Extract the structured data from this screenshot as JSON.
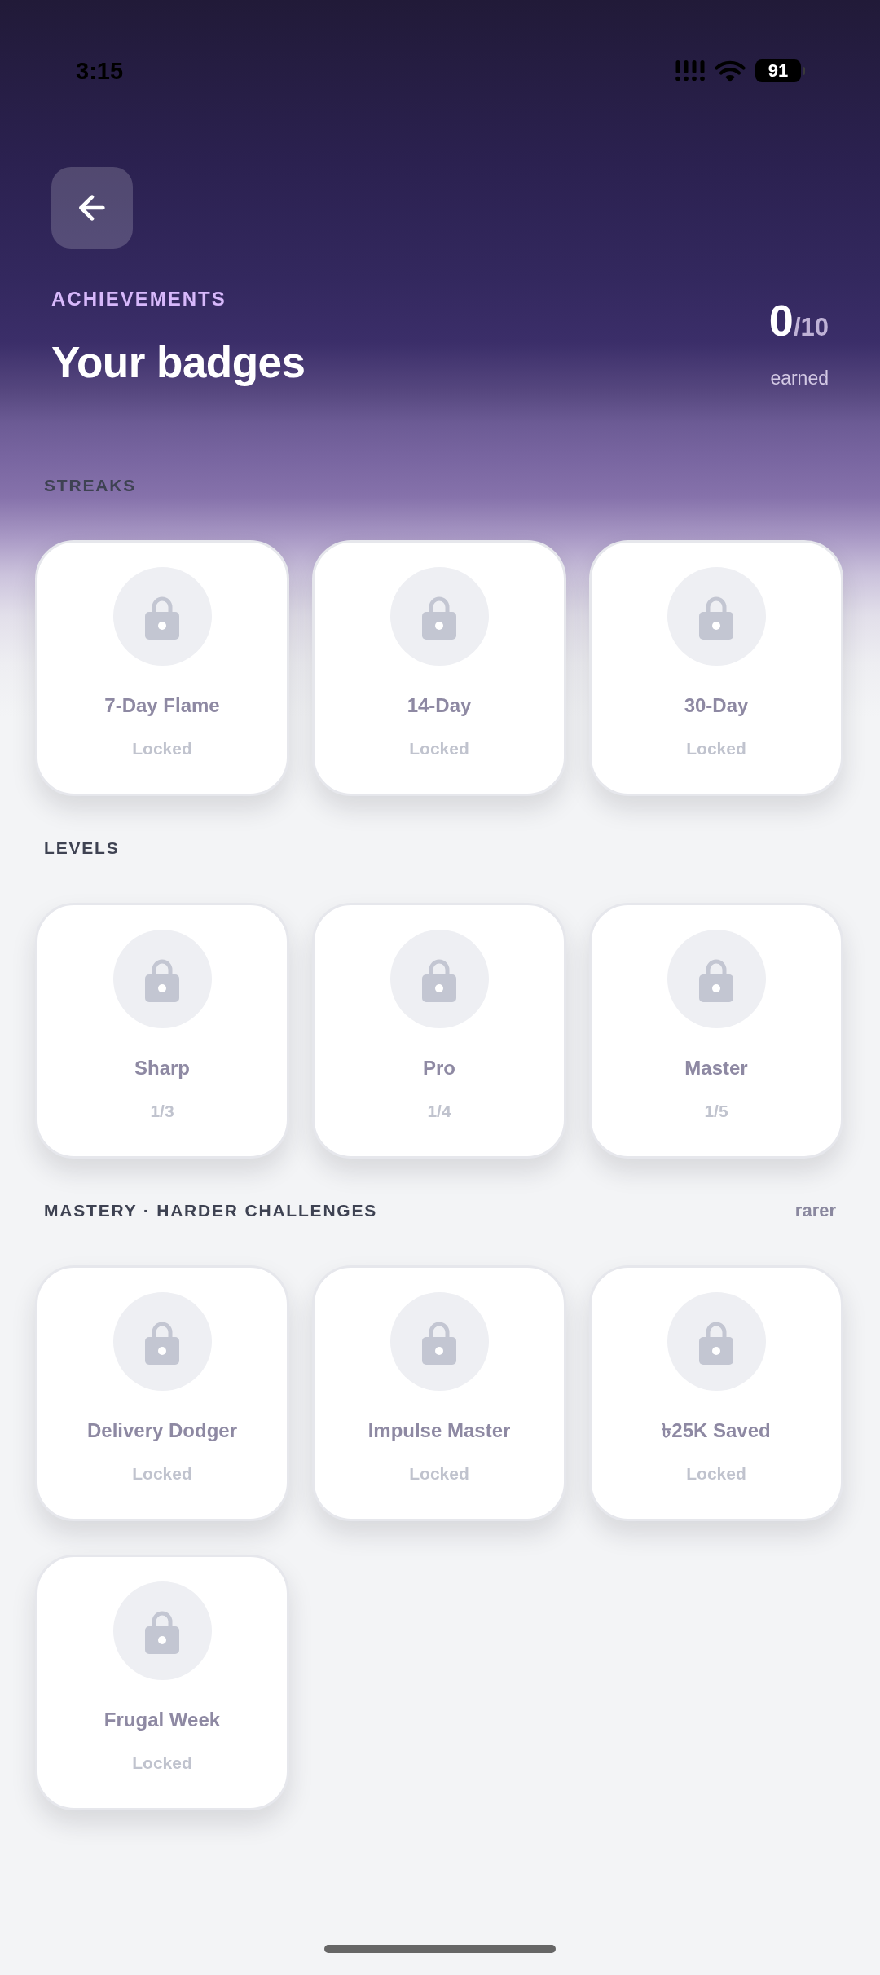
{
  "status_bar": {
    "time": "3:15",
    "battery": "91"
  },
  "header": {
    "eyebrow": "ACHIEVEMENTS",
    "title": "Your badges",
    "earned_count": "0",
    "total": "/10",
    "earned_label": "earned"
  },
  "sections": [
    {
      "title": "STREAKS",
      "badges": [
        {
          "name": "7-Day Flame",
          "status": "Locked",
          "locked": true
        },
        {
          "name": "14-Day",
          "status": "Locked",
          "locked": true
        },
        {
          "name": "30-Day",
          "status": "Locked",
          "locked": true
        }
      ]
    },
    {
      "title": "LEVELS",
      "badges": [
        {
          "name": "Sharp",
          "status": "1/3",
          "locked": true
        },
        {
          "name": "Pro",
          "status": "1/4",
          "locked": true
        },
        {
          "name": "Master",
          "status": "1/5",
          "locked": true
        }
      ]
    },
    {
      "title": "MASTERY · HARDER CHALLENGES",
      "note": "rarer",
      "badges": [
        {
          "name": "Delivery Dodger",
          "status": "Locked",
          "locked": true
        },
        {
          "name": "Impulse Master",
          "status": "Locked",
          "locked": true
        },
        {
          "name": "৳25K Saved",
          "status": "Locked",
          "locked": true
        },
        {
          "name": "Frugal Week",
          "status": "Locked",
          "locked": true
        }
      ]
    }
  ]
}
